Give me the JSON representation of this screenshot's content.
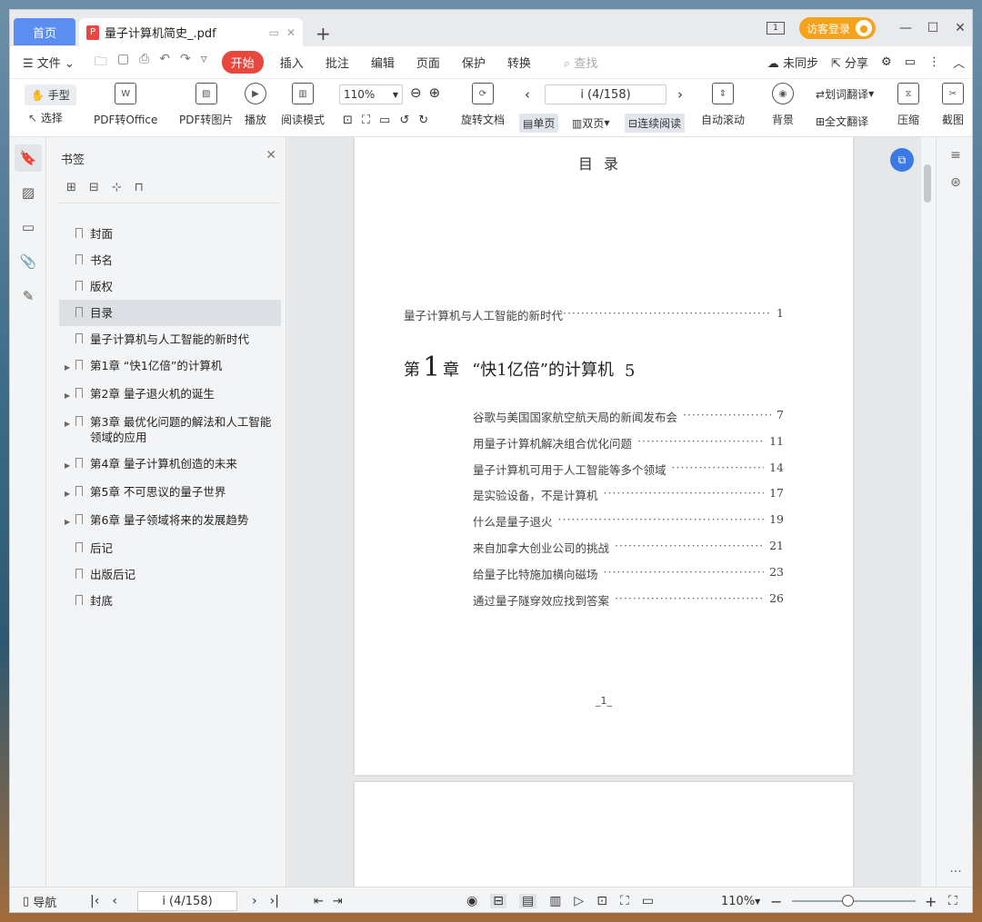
{
  "titlebar": {
    "home_tab": "首页",
    "doc_tab": "量子计算机简史_.pdf",
    "new_tab": "+",
    "login": "访客登录",
    "minimize": "—",
    "maximize": "☐",
    "close": "✕"
  },
  "menu": {
    "file": "文件",
    "start": "开始",
    "items": [
      "插入",
      "批注",
      "编辑",
      "页面",
      "保护",
      "转换"
    ],
    "search": "查找",
    "sync": "未同步",
    "share": "分享"
  },
  "toolbar": {
    "hand": "手型",
    "select": "选择",
    "pdf_to_office": "PDF转Office",
    "pdf_to_image": "PDF转图片",
    "play": "播放",
    "read_mode": "阅读模式",
    "zoom": "110%",
    "rotate": "旋转文档",
    "page_indicator": "i (4/158)",
    "single_page": "单页",
    "double_page": "双页",
    "continuous": "连续阅读",
    "auto_scroll": "自动滚动",
    "background": "背景",
    "word_translate": "划词翻译",
    "full_translate": "全文翻译",
    "compress": "压缩",
    "screenshot": "截图"
  },
  "sidebar": {
    "title": "书签",
    "items": [
      {
        "label": "封面",
        "expandable": false
      },
      {
        "label": "书名",
        "expandable": false
      },
      {
        "label": "版权",
        "expandable": false
      },
      {
        "label": "目录",
        "expandable": false,
        "selected": true
      },
      {
        "label": "量子计算机与人工智能的新时代",
        "expandable": false
      },
      {
        "label": "第1章 “快1亿倍”的计算机",
        "expandable": true
      },
      {
        "label": "第2章 量子退火机的诞生",
        "expandable": true
      },
      {
        "label": "第3章 最优化问题的解法和人工智能领域的应用",
        "expandable": true
      },
      {
        "label": "第4章 量子计算机创造的未来",
        "expandable": true
      },
      {
        "label": "第5章 不可思议的量子世界",
        "expandable": true
      },
      {
        "label": "第6章 量子领域将来的发展趋势",
        "expandable": true
      },
      {
        "label": "后记",
        "expandable": false
      },
      {
        "label": "出版后记",
        "expandable": false
      },
      {
        "label": "封底",
        "expandable": false
      }
    ]
  },
  "document": {
    "toc_title": "目录",
    "intro": {
      "text": "量子计算机与人工智能的新时代",
      "page": "1"
    },
    "chapter": {
      "prefix": "第",
      "num": "1",
      "suffix": "章",
      "title": "“快1亿倍”的计算机",
      "page": "5"
    },
    "entries": [
      {
        "text": "谷歌与美国国家航空航天局的新闻发布会",
        "page": "7"
      },
      {
        "text": "用量子计算机解决组合优化问题",
        "page": "11"
      },
      {
        "text": "量子计算机可用于人工智能等多个领域",
        "page": "14"
      },
      {
        "text": "是实验设备，不是计算机",
        "page": "17"
      },
      {
        "text": "什么是量子退火",
        "page": "19"
      },
      {
        "text": "来自加拿大创业公司的挑战",
        "page": "21"
      },
      {
        "text": "给量子比特施加横向磁场",
        "page": "23"
      },
      {
        "text": "通过量子隧穿效应找到答案",
        "page": "26"
      }
    ],
    "page_number": "_1_"
  },
  "statusbar": {
    "nav": "导航",
    "page_indicator": "i (4/158)",
    "zoom": "110%",
    "zoom_level": 0.45
  }
}
